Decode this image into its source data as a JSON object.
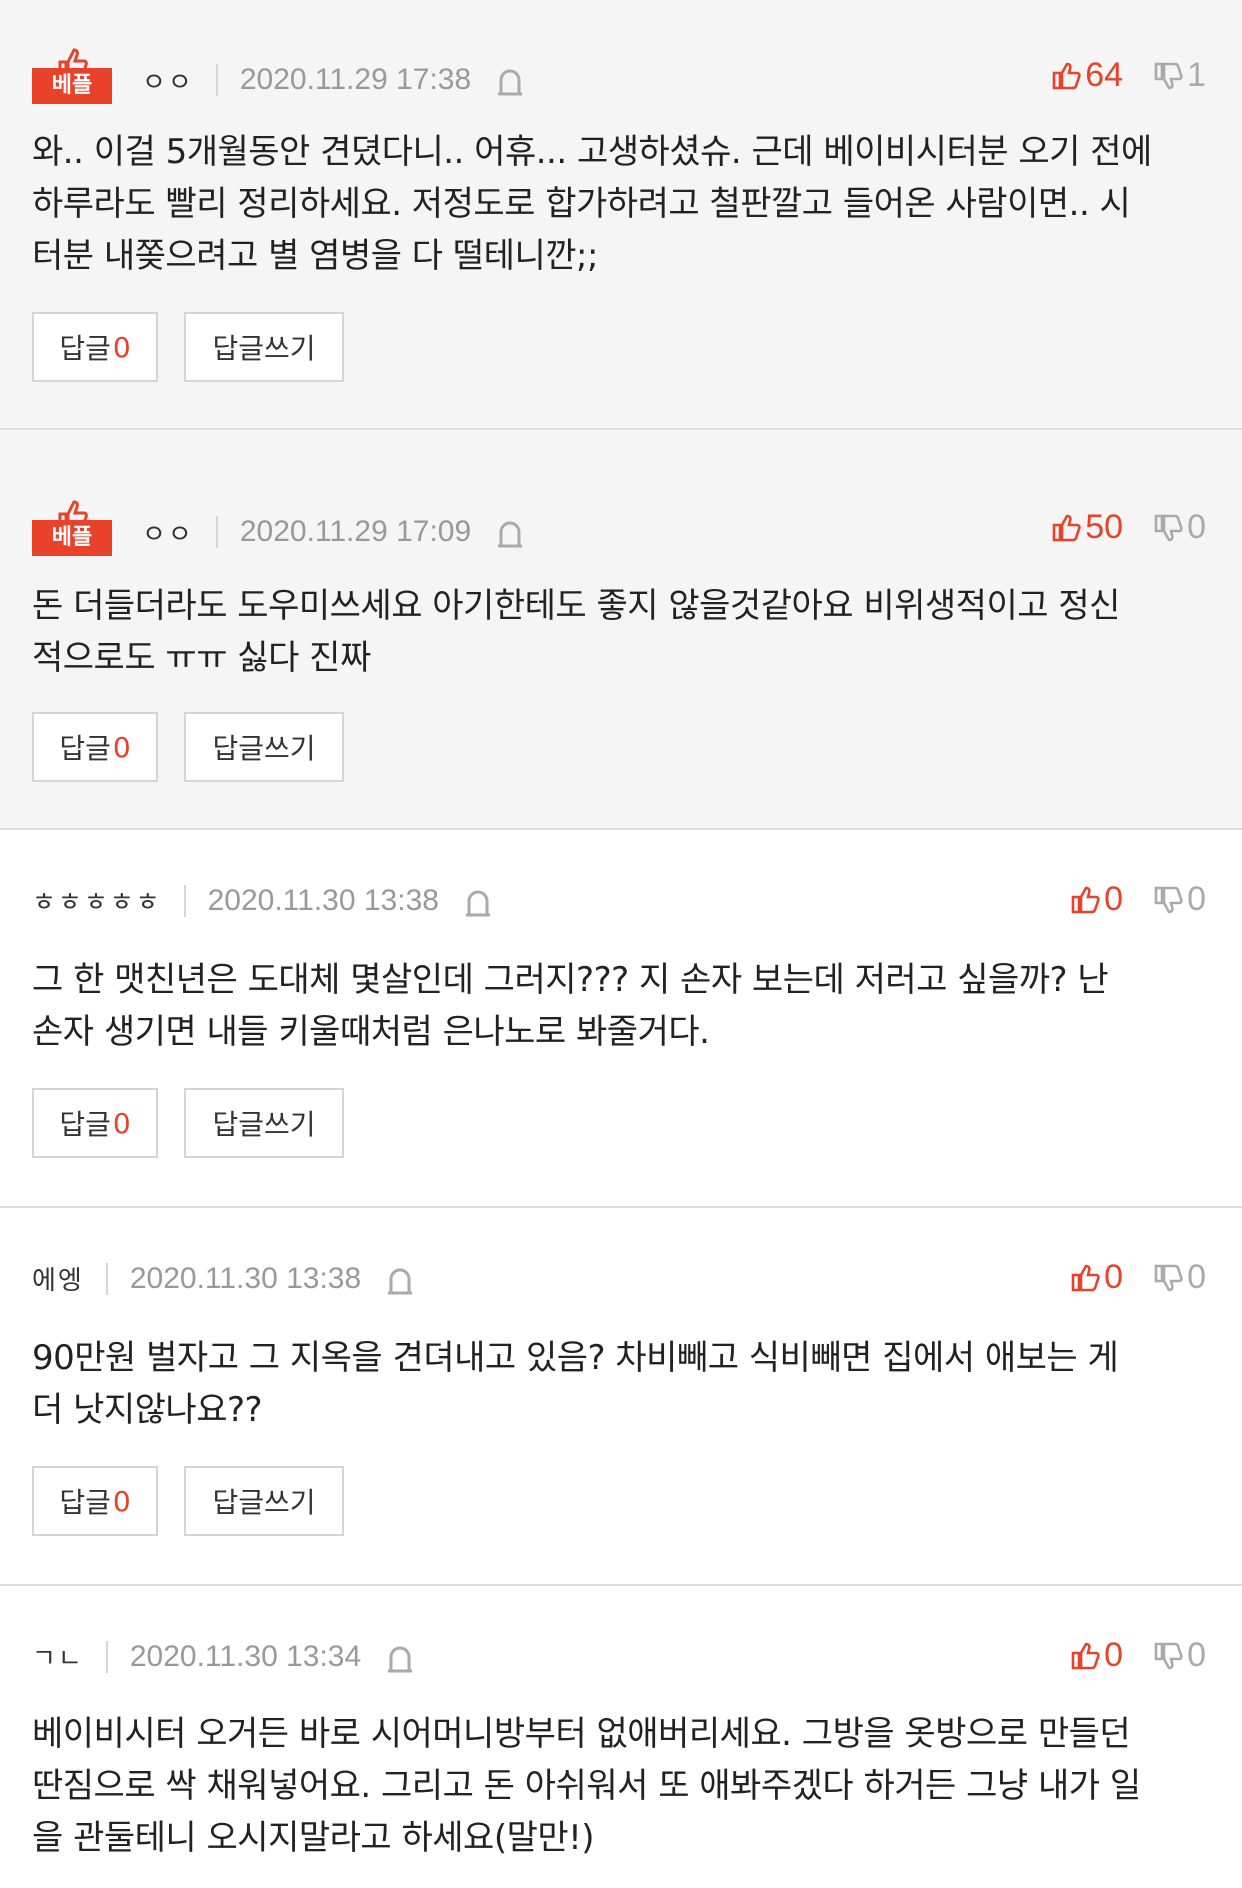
{
  "colors": {
    "accent": "#e8432a",
    "muted": "#999999",
    "best_bg": "#f5f5f5"
  },
  "labels": {
    "best": "베플",
    "reply": "답글",
    "write_reply": "답글쓰기"
  },
  "comments": [
    {
      "best": true,
      "author": "ㅇㅇ",
      "date": "2020.11.29 17:38",
      "up": "64",
      "down": "1",
      "lines": [
        "와.. 이걸 5개월동안 견뎠다니.. 어휴... 고생하셨슈. 근데 베이비시터분 오기 전에",
        "하루라도 빨리 정리하세요. 저정도로 합가하려고 철판깔고 들어온 사람이면.. 시",
        "터분 내쫒으려고 별 염병을 다 떨테니깐;;"
      ],
      "replies": "0"
    },
    {
      "best": true,
      "author": "ㅇㅇ",
      "date": "2020.11.29 17:09",
      "up": "50",
      "down": "0",
      "lines": [
        "돈 더들더라도 도우미쓰세요 아기한테도 좋지 않을것같아요 비위생적이고 정신",
        "적으로도 ㅠㅠ 싫다 진짜"
      ],
      "replies": "0"
    },
    {
      "best": false,
      "author": "ㅎㅎㅎㅎㅎ",
      "date": "2020.11.30 13:38",
      "up": "0",
      "down": "0",
      "lines": [
        "그 한 맷친년은 도대체 몇살인데 그러지??? 지 손자 보는데 저러고 싶을까? 난",
        "손자 생기면 내들 키울때처럼 은나노로 봐줄거다."
      ],
      "replies": "0"
    },
    {
      "best": false,
      "author": "에엥",
      "date": "2020.11.30 13:38",
      "up": "0",
      "down": "0",
      "lines": [
        "90만원 벌자고 그 지옥을 견뎌내고 있음? 차비빼고 식비빼면 집에서 애보는 게",
        "더 낫지않나요??"
      ],
      "replies": "0"
    },
    {
      "best": false,
      "author": "ㄱㄴ",
      "date": "2020.11.30 13:34",
      "up": "0",
      "down": "0",
      "lines": [
        "베이비시터 오거든 바로 시어머니방부터 없애버리세요. 그방을 옷방으로 만들던",
        "딴짐으로 싹 채워넣어요. 그리고 돈 아쉬워서 또 애봐주겠다 하거든 그냥 내가 일",
        "을 관둘테니 오시지말라고 하세요(말만!)"
      ],
      "replies": null
    }
  ]
}
